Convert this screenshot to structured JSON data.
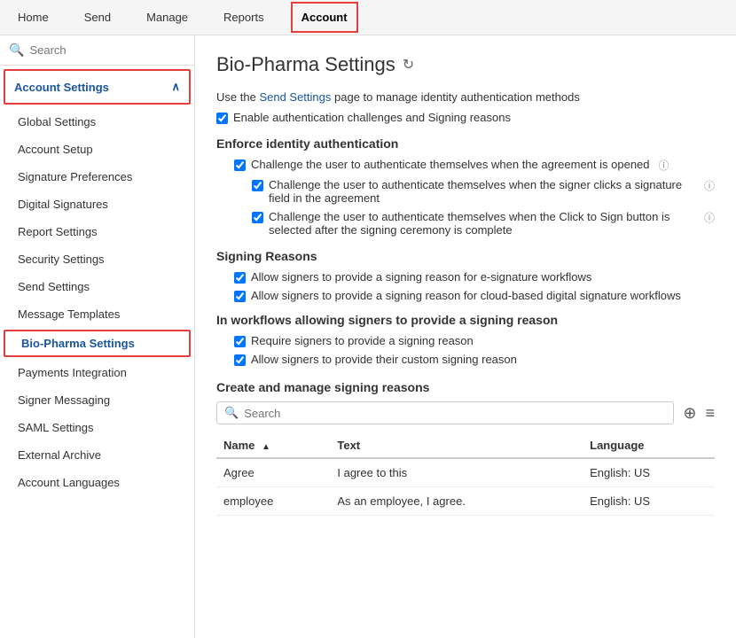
{
  "nav": {
    "items": [
      {
        "label": "Home",
        "active": false
      },
      {
        "label": "Send",
        "active": false
      },
      {
        "label": "Manage",
        "active": false
      },
      {
        "label": "Reports",
        "active": false
      },
      {
        "label": "Account",
        "active": true
      }
    ]
  },
  "sidebar": {
    "search_placeholder": "Search",
    "section_header": "Account Settings",
    "items": [
      {
        "label": "Global Settings",
        "active": false
      },
      {
        "label": "Account Setup",
        "active": false
      },
      {
        "label": "Signature Preferences",
        "active": false
      },
      {
        "label": "Digital Signatures",
        "active": false
      },
      {
        "label": "Report Settings",
        "active": false
      },
      {
        "label": "Security Settings",
        "active": false
      },
      {
        "label": "Send Settings",
        "active": false
      },
      {
        "label": "Message Templates",
        "active": false
      },
      {
        "label": "Bio-Pharma Settings",
        "active": true
      },
      {
        "label": "Payments Integration",
        "active": false
      },
      {
        "label": "Signer Messaging",
        "active": false
      },
      {
        "label": "SAML Settings",
        "active": false
      },
      {
        "label": "External Archive",
        "active": false
      },
      {
        "label": "Account Languages",
        "active": false
      }
    ]
  },
  "content": {
    "page_title": "Bio-Pharma Settings",
    "intro_text": "Use the",
    "intro_link": "Send Settings",
    "intro_rest": "page to manage identity authentication methods",
    "enable_auth_label": "Enable authentication challenges and Signing reasons",
    "enforce_section": "Enforce identity authentication",
    "challenge_items": [
      {
        "label": "Challenge the user to authenticate themselves when the agreement is opened",
        "checked": true,
        "has_help": true
      },
      {
        "label": "Challenge the user to authenticate themselves when the signer clicks a signature field in the agreement",
        "checked": true,
        "has_help": true
      },
      {
        "label": "Challenge the user to authenticate themselves when the Click to Sign button is selected after the signing ceremony is complete",
        "checked": true,
        "has_help": true
      }
    ],
    "signing_reasons_section": "Signing Reasons",
    "signing_reason_items": [
      {
        "label": "Allow signers to provide a signing reason for e-signature workflows",
        "checked": true
      },
      {
        "label": "Allow signers to provide a signing reason for cloud-based digital signature workflows",
        "checked": true
      }
    ],
    "in_workflows_section": "In workflows allowing signers to provide a signing reason",
    "in_workflows_items": [
      {
        "label": "Require signers to provide a signing reason",
        "checked": true
      },
      {
        "label": "Allow signers to provide their custom signing reason",
        "checked": true
      }
    ],
    "create_manage_title": "Create and manage signing reasons",
    "search_placeholder": "Search",
    "table": {
      "columns": [
        {
          "label": "Name",
          "sort": "asc"
        },
        {
          "label": "Text",
          "sort": "none"
        },
        {
          "label": "Language",
          "sort": "none"
        }
      ],
      "rows": [
        {
          "name": "Agree",
          "text": "I agree to this",
          "language": "English: US"
        },
        {
          "name": "employee",
          "text": "As an employee, I agree.",
          "language": "English: US"
        }
      ]
    }
  },
  "icons": {
    "search": "🔍",
    "chevron_up": "∧",
    "refresh": "↻",
    "help": "?",
    "add": "⊕",
    "menu": "≡",
    "sort_asc": "▲"
  }
}
